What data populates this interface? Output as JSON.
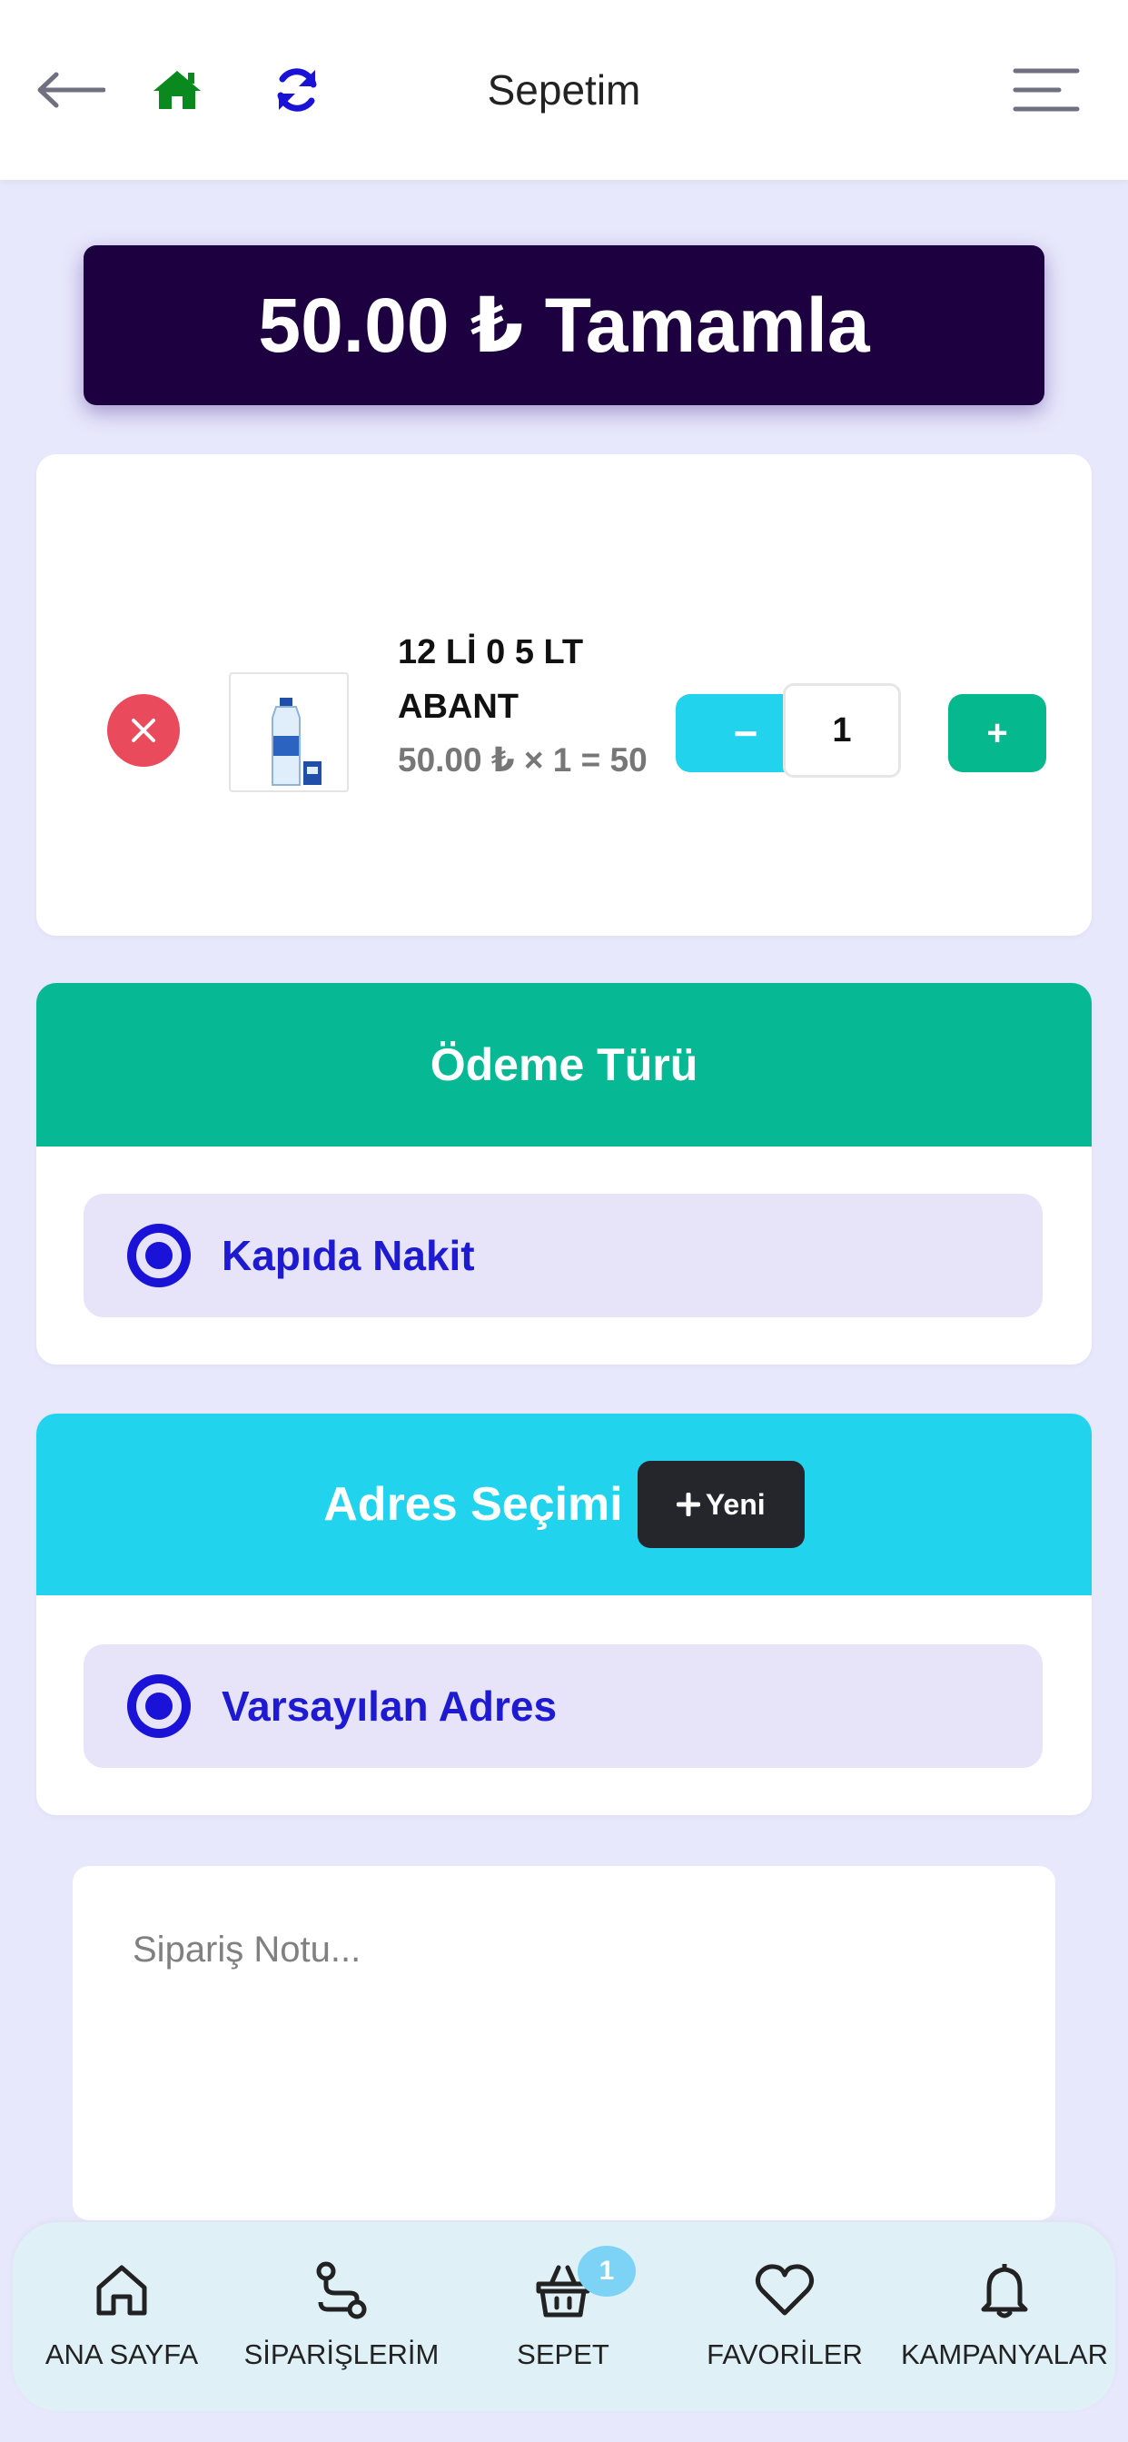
{
  "header": {
    "title": "Sepetim"
  },
  "complete_button": {
    "label": "50.00 ₺ Tamamla"
  },
  "cart": {
    "items": [
      {
        "name": "12 Lİ 0 5 LT ABANT",
        "price_line": "50.00 ₺ × 1 = 50",
        "quantity": "1"
      }
    ],
    "minus_label": "−",
    "plus_label": "+"
  },
  "payment": {
    "title": "Ödeme Türü",
    "options": [
      {
        "label": "Kapıda Nakit",
        "selected": true
      }
    ]
  },
  "address": {
    "title": "Adres Seçimi",
    "new_button_label": "Yeni",
    "options": [
      {
        "label": "Varsayılan Adres",
        "selected": true
      }
    ]
  },
  "note": {
    "placeholder": "Sipariş Notu..."
  },
  "bottom_nav": {
    "items": [
      {
        "label": "ANA SAYFA",
        "icon": "home-icon"
      },
      {
        "label": "SİPARİŞLERİM",
        "icon": "route-icon"
      },
      {
        "label": "SEPET",
        "icon": "basket-icon",
        "badge": "1"
      },
      {
        "label": "FAVORİLER",
        "icon": "heart-icon"
      },
      {
        "label": "KAMPANYALAR",
        "icon": "bell-icon"
      }
    ]
  },
  "colors": {
    "page_background": "#e8e8fc",
    "complete_button": "#1c0040",
    "payment_header": "#06b894",
    "address_header": "#22d3ee",
    "option_background": "#e7e4fa",
    "option_text": "#1e1ad2",
    "remove_button": "#e94a5c",
    "minus_button": "#22d3ee",
    "plus_button": "#06b88e",
    "nav_background": "#dff0f7",
    "badge": "#7cd3f6",
    "home_icon": "#0a8a1e",
    "refresh_icon": "#1a12d6"
  }
}
